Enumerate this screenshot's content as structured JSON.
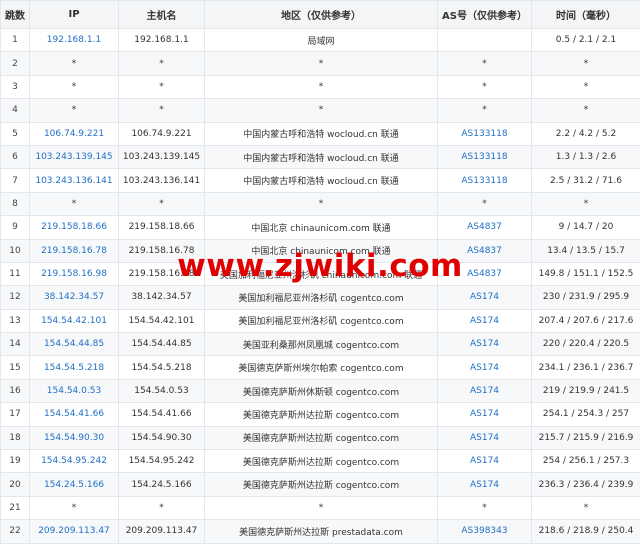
{
  "headers": {
    "hop": "跳数",
    "ip": "IP",
    "host": "主机名",
    "location": "地区（仅供参考）",
    "asn": "AS号（仅供参考）",
    "time": "时间（毫秒）"
  },
  "rows": [
    {
      "hop": "1",
      "ip": "192.168.1.1",
      "host": "192.168.1.1",
      "location": "局域网",
      "asn": "",
      "time": "0.5 / 2.1 / 2.1"
    },
    {
      "hop": "2",
      "ip": "*",
      "host": "*",
      "location": "*",
      "asn": "*",
      "time": "*"
    },
    {
      "hop": "3",
      "ip": "*",
      "host": "*",
      "location": "*",
      "asn": "*",
      "time": "*"
    },
    {
      "hop": "4",
      "ip": "*",
      "host": "*",
      "location": "*",
      "asn": "*",
      "time": "*"
    },
    {
      "hop": "5",
      "ip": "106.74.9.221",
      "host": "106.74.9.221",
      "location": "中国内蒙古呼和浩特 wocloud.cn 联通",
      "asn": "AS133118",
      "time": "2.2 / 4.2 / 5.2"
    },
    {
      "hop": "6",
      "ip": "103.243.139.145",
      "host": "103.243.139.145",
      "location": "中国内蒙古呼和浩特 wocloud.cn 联通",
      "asn": "AS133118",
      "time": "1.3 / 1.3 / 2.6"
    },
    {
      "hop": "7",
      "ip": "103.243.136.141",
      "host": "103.243.136.141",
      "location": "中国内蒙古呼和浩特 wocloud.cn 联通",
      "asn": "AS133118",
      "time": "2.5 / 31.2 / 71.6"
    },
    {
      "hop": "8",
      "ip": "*",
      "host": "*",
      "location": "*",
      "asn": "*",
      "time": "*"
    },
    {
      "hop": "9",
      "ip": "219.158.18.66",
      "host": "219.158.18.66",
      "location": "中国北京 chinaunicom.com 联通",
      "asn": "AS4837",
      "time": "9 / 14.7 / 20"
    },
    {
      "hop": "10",
      "ip": "219.158.16.78",
      "host": "219.158.16.78",
      "location": "中国北京 chinaunicom.com 联通",
      "asn": "AS4837",
      "time": "13.4 / 13.5 / 15.7"
    },
    {
      "hop": "11",
      "ip": "219.158.16.98",
      "host": "219.158.16.98",
      "location": "美国加利福尼亚州洛杉矶 chinaunicom.com 联通",
      "asn": "AS4837",
      "time": "149.8 / 151.1 / 152.5"
    },
    {
      "hop": "12",
      "ip": "38.142.34.57",
      "host": "38.142.34.57",
      "location": "美国加利福尼亚州洛杉矶 cogentco.com",
      "asn": "AS174",
      "time": "230 / 231.9 / 295.9"
    },
    {
      "hop": "13",
      "ip": "154.54.42.101",
      "host": "154.54.42.101",
      "location": "美国加利福尼亚州洛杉矶 cogentco.com",
      "asn": "AS174",
      "time": "207.4 / 207.6 / 217.6"
    },
    {
      "hop": "14",
      "ip": "154.54.44.85",
      "host": "154.54.44.85",
      "location": "美国亚利桑那州凤凰城 cogentco.com",
      "asn": "AS174",
      "time": "220 / 220.4 / 220.5"
    },
    {
      "hop": "15",
      "ip": "154.54.5.218",
      "host": "154.54.5.218",
      "location": "美国德克萨斯州埃尔帕索 cogentco.com",
      "asn": "AS174",
      "time": "234.1 / 236.1 / 236.7"
    },
    {
      "hop": "16",
      "ip": "154.54.0.53",
      "host": "154.54.0.53",
      "location": "美国德克萨斯州休斯顿 cogentco.com",
      "asn": "AS174",
      "time": "219 / 219.9 / 241.5"
    },
    {
      "hop": "17",
      "ip": "154.54.41.66",
      "host": "154.54.41.66",
      "location": "美国德克萨斯州达拉斯 cogentco.com",
      "asn": "AS174",
      "time": "254.1 / 254.3 / 257"
    },
    {
      "hop": "18",
      "ip": "154.54.90.30",
      "host": "154.54.90.30",
      "location": "美国德克萨斯州达拉斯 cogentco.com",
      "asn": "AS174",
      "time": "215.7 / 215.9 / 216.9"
    },
    {
      "hop": "19",
      "ip": "154.54.95.242",
      "host": "154.54.95.242",
      "location": "美国德克萨斯州达拉斯 cogentco.com",
      "asn": "AS174",
      "time": "254 / 256.1 / 257.3"
    },
    {
      "hop": "20",
      "ip": "154.24.5.166",
      "host": "154.24.5.166",
      "location": "美国德克萨斯州达拉斯 cogentco.com",
      "asn": "AS174",
      "time": "236.3 / 236.4 / 239.9"
    },
    {
      "hop": "21",
      "ip": "*",
      "host": "*",
      "location": "*",
      "asn": "*",
      "time": "*"
    },
    {
      "hop": "22",
      "ip": "209.209.113.47",
      "host": "209.209.113.47",
      "location": "美国德克萨斯州达拉斯 prestadata.com",
      "asn": "AS398343",
      "time": "218.6 / 218.9 / 250.4"
    }
  ],
  "watermark": "www.zjwiki.com",
  "colors": {
    "link": "#1f6fc5",
    "watermark": "#e00000",
    "header_bg": "#f4f5f7"
  }
}
